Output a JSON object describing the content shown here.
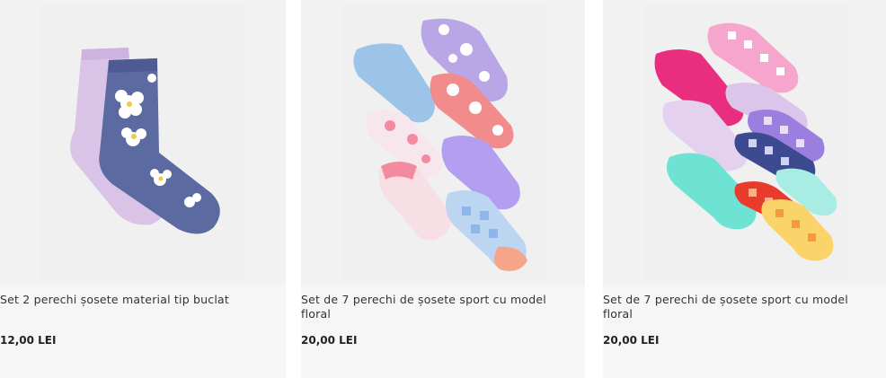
{
  "products": [
    {
      "title": "Set 2 perechi șosete material tip buclat",
      "price": "12,00 LEI",
      "image_icon": "floral-socks-image"
    },
    {
      "title": "Set de 7 perechi de șosete sport cu model floral",
      "price": "20,00 LEI",
      "image_icon": "sport-socks-pastel-image"
    },
    {
      "title": "Set de 7 perechi de șosete sport cu model floral",
      "price": "20,00 LEI",
      "image_icon": "sport-socks-checkered-image"
    }
  ]
}
